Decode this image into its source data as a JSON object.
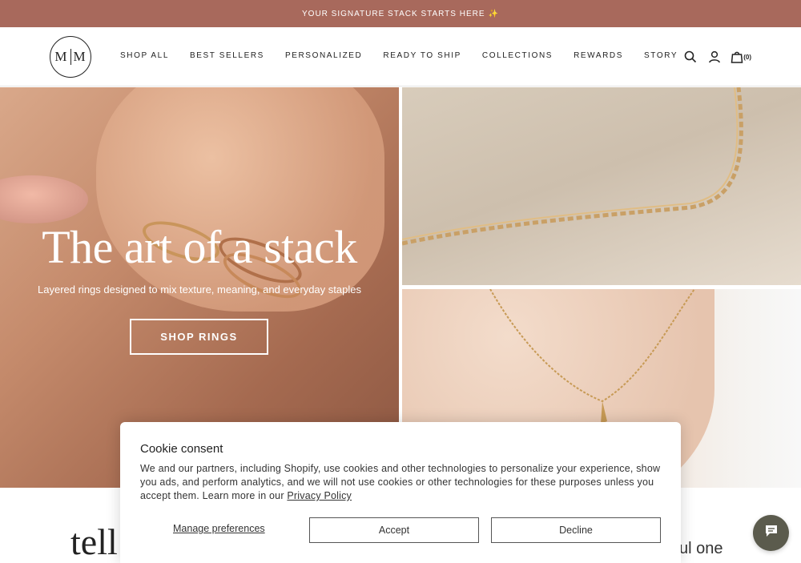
{
  "announcement": {
    "text": "YOUR SIGNATURE STACK STARTS HERE",
    "spark": "✨"
  },
  "header": {
    "logo_left": "M",
    "logo_right": "M",
    "nav": [
      "SHOP ALL",
      "BEST SELLERS",
      "PERSONALIZED",
      "READY TO SHIP",
      "COLLECTIONS",
      "REWARDS",
      "STORY"
    ],
    "cart_count": "(0)",
    "icons": [
      "search-icon",
      "account-icon",
      "bag-icon"
    ]
  },
  "hero": {
    "title": "The art of a stack",
    "subtitle": "Layered rings designed to mix texture, meaning, and everyday staples",
    "button": "SHOP RINGS"
  },
  "below": {
    "left_text": "tell",
    "right_text": "iful one"
  },
  "cookie": {
    "title": "Cookie consent",
    "body": "We and our partners, including Shopify, use cookies and other technologies to personalize your experience, show you ads, and perform analytics, and we will not use cookies or other technologies for these purposes unless you accept them. Learn more in our",
    "link": "Privacy Policy",
    "manage": "Manage preferences",
    "accept": "Accept",
    "decline": "Decline"
  },
  "colors": {
    "announcement_bg": "#a8695c",
    "chat_bg": "#5b5b4d"
  }
}
